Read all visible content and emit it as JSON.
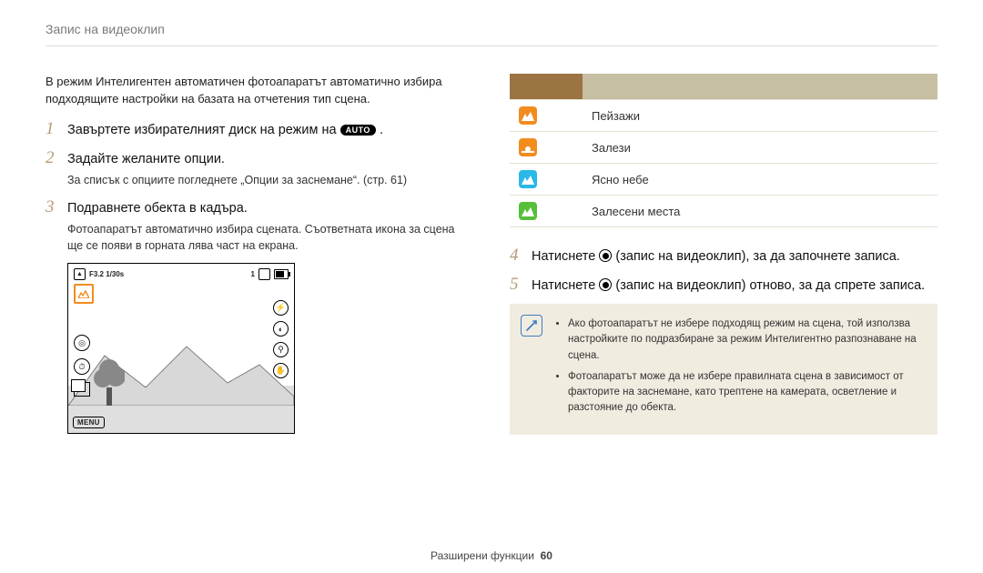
{
  "header": {
    "title": "Запис на видеоклип"
  },
  "left": {
    "intro": "В режим Интелигентен автоматичен фотоапаратът автоматично избира подходящите настройки на базата на отчетения тип сцена.",
    "steps": {
      "s1": {
        "num": "1",
        "title_a": "Завъртете избирателният диск на режим на ",
        "auto": "AUTO",
        "title_b": " ."
      },
      "s2": {
        "num": "2",
        "title": "Задайте желаните опции.",
        "sub": "За списък с опциите погледнете „Опции за заснемане“. (стр. 61)"
      },
      "s3": {
        "num": "3",
        "title": "Подравнете обекта в кадъра.",
        "sub": "Фотоапаратът автоматично избира сцената. Съответната икона за сцена ще се появи в горната лява част на екрана."
      }
    },
    "shot": {
      "exposure": "F3.2  1/30s",
      "card": "1",
      "menu": "MENU"
    }
  },
  "right": {
    "table": {
      "rows": [
        {
          "color": "orange",
          "label": "Пейзажи"
        },
        {
          "color": "orange",
          "label": "Залези"
        },
        {
          "color": "blue",
          "label": "Ясно небе"
        },
        {
          "color": "green",
          "label": "Залесени места"
        }
      ]
    },
    "steps": {
      "s4": {
        "num": "4",
        "title_a": "Натиснете ",
        "title_b": " (запис на видеоклип), за да започнете записа."
      },
      "s5": {
        "num": "5",
        "title_a": "Натиснете ",
        "title_b": " (запис на видеоклип) отново, за да спрете записа."
      }
    },
    "note": {
      "b1": "Ако фотоапаратът не избере подходящ режим на сцена, той използва настройките по подразбиране за режим Интелигентно разпознаване на сцена.",
      "b2": "Фотоапаратът може да не избере правилната сцена в зависимост от факторите на заснемане, като трептене на камерата, осветление и разстояние до обекта."
    }
  },
  "footer": {
    "section": "Разширени функции",
    "page": "60"
  }
}
